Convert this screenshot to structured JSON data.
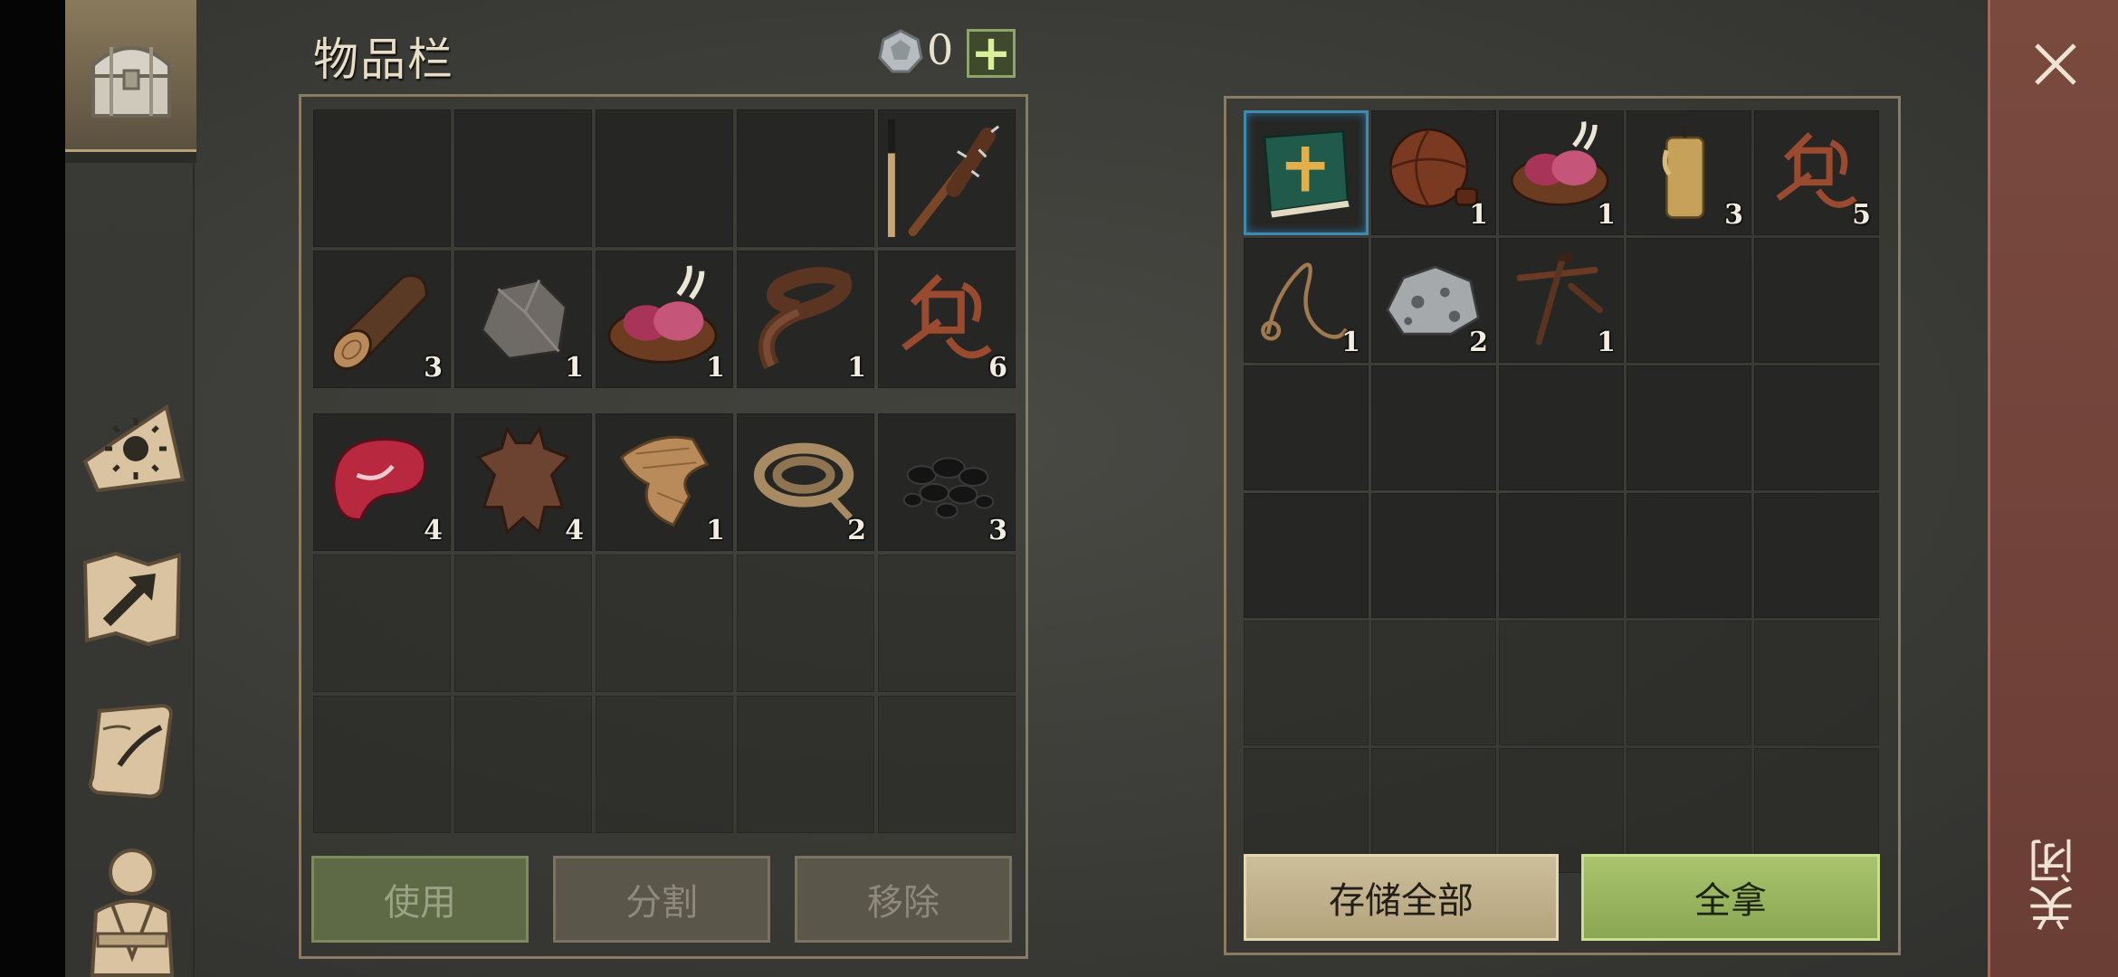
{
  "inventory": {
    "title": "物品栏",
    "coin_count": "0",
    "plus_label": "+",
    "top_slots": [
      {
        "icon": "empty"
      },
      {
        "icon": "empty"
      },
      {
        "icon": "empty"
      },
      {
        "icon": "empty"
      },
      {
        "icon": "spiked-club-icon",
        "qty": ""
      },
      {
        "icon": "log-icon",
        "qty": "3"
      },
      {
        "icon": "stone-icon",
        "qty": "1"
      },
      {
        "icon": "raw-meat-bowl-icon",
        "qty": "1"
      },
      {
        "icon": "leather-strip-icon",
        "qty": "1"
      },
      {
        "icon": "scrap-parts-icon",
        "qty": "6"
      }
    ],
    "bag_slots": [
      {
        "icon": "raw-steak-icon",
        "qty": "4"
      },
      {
        "icon": "animal-hide-icon",
        "qty": "4"
      },
      {
        "icon": "cloth-icon",
        "qty": "1"
      },
      {
        "icon": "rope-icon",
        "qty": "2"
      },
      {
        "icon": "coal-icon",
        "qty": "3"
      }
    ],
    "buttons": {
      "use": "使用",
      "split": "分割",
      "remove": "移除"
    }
  },
  "storage": {
    "slots": [
      {
        "icon": "green-book-icon",
        "qty": "",
        "selected": true
      },
      {
        "icon": "leather-flask-icon",
        "qty": "1"
      },
      {
        "icon": "raw-meat-bowl-icon",
        "qty": "1"
      },
      {
        "icon": "candle-icon",
        "qty": "3"
      },
      {
        "icon": "scrap-parts-icon",
        "qty": "5"
      },
      {
        "icon": "string-icon",
        "qty": "1"
      },
      {
        "icon": "iron-ore-icon",
        "qty": "2"
      },
      {
        "icon": "nails-icon",
        "qty": "1"
      }
    ],
    "buttons": {
      "store_all": "存储全部",
      "take_all": "全拿"
    }
  },
  "close": {
    "label": "关闭"
  },
  "colors": {
    "accent_green": "#8aa653",
    "selection_blue": "#3f8bb0",
    "close_red": "#7a4a3f"
  }
}
